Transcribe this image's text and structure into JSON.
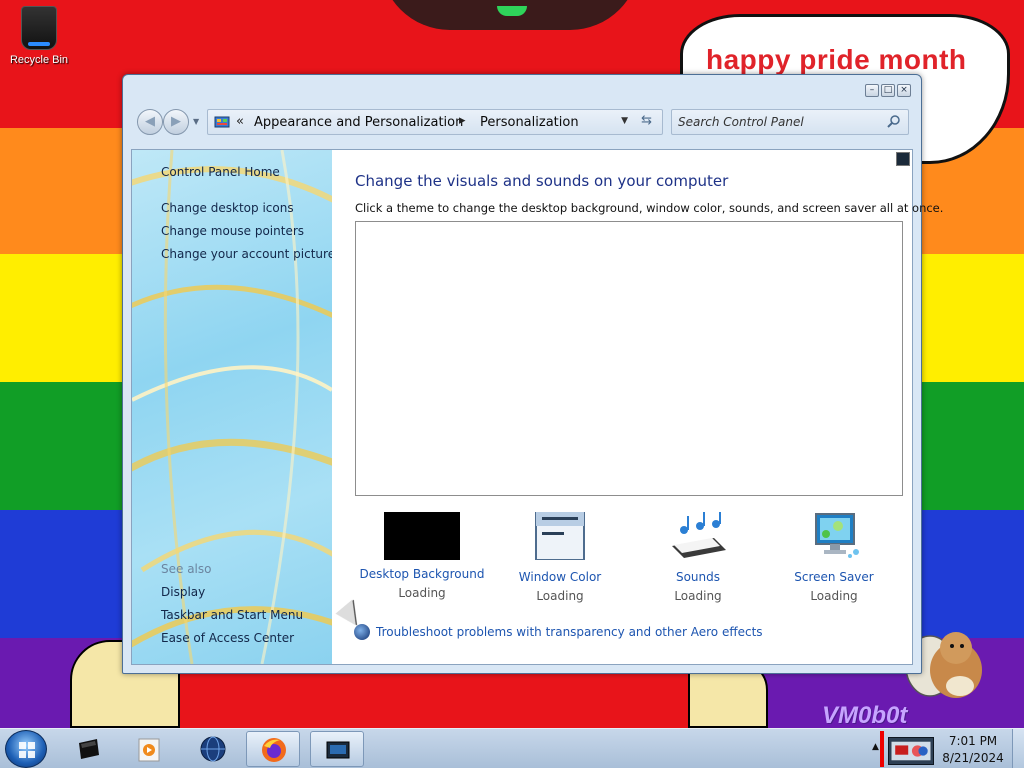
{
  "desktop": {
    "recycle_bin_label": "Recycle Bin",
    "speech_bubble_text": "happy pride month",
    "watermark_text": "VM0b0t"
  },
  "window": {
    "nav": {
      "breadcrumb_parent": "Appearance and Personalization",
      "breadcrumb_current": "Personalization",
      "search_placeholder": "Search Control Panel"
    },
    "sidebar": {
      "home_link": "Control Panel Home",
      "links": [
        "Change desktop icons",
        "Change mouse pointers",
        "Change your account picture"
      ],
      "see_also_label": "See also",
      "see_also_links": [
        "Display",
        "Taskbar and Start Menu",
        "Ease of Access Center"
      ]
    },
    "main": {
      "title": "Change the visuals and sounds on your computer",
      "description": "Click a theme to change the desktop background, window color, sounds, and screen saver all at once.",
      "options": [
        {
          "label": "Desktop Background",
          "status": "Loading",
          "icon": "desktop-background-icon"
        },
        {
          "label": "Window Color",
          "status": "Loading",
          "icon": "window-color-icon"
        },
        {
          "label": "Sounds",
          "status": "Loading",
          "icon": "sounds-icon"
        },
        {
          "label": "Screen Saver",
          "status": "Loading",
          "icon": "screen-saver-icon"
        }
      ],
      "troubleshoot_link": "Troubleshoot problems with transparency and other Aero effects"
    }
  },
  "taskbar": {
    "items": [
      "terminal-icon",
      "media-player-icon",
      "globe-icon",
      "firefox-icon",
      "control-panel-icon"
    ],
    "clock_time": "7:01 PM",
    "clock_date": "8/21/2024"
  },
  "colors": {
    "link_blue": "#1d55b0",
    "title_blue": "#1e3287",
    "bubble_text_red": "#e0232a"
  }
}
